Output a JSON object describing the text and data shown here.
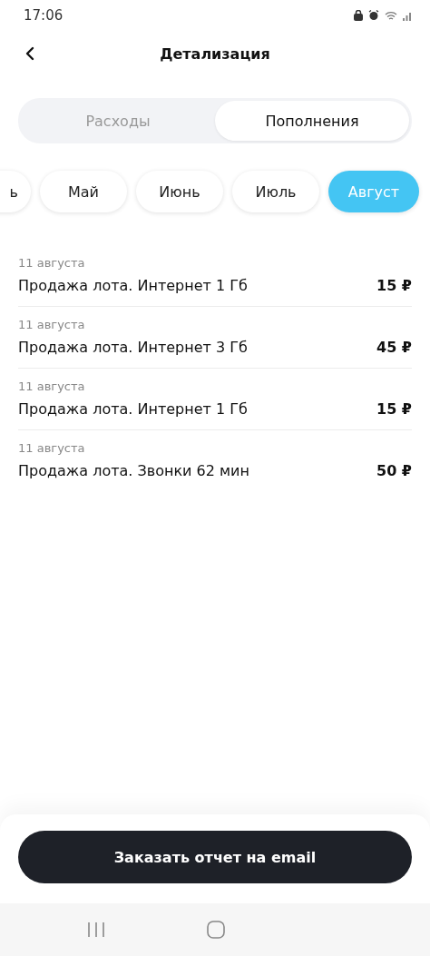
{
  "status_bar": {
    "time": "17:06"
  },
  "header": {
    "title": "Детализация"
  },
  "segments": [
    {
      "label": "Расходы",
      "selected": false
    },
    {
      "label": "Пополнения",
      "selected": true
    }
  ],
  "months": [
    {
      "label": "ь",
      "selected": false
    },
    {
      "label": "Май",
      "selected": false
    },
    {
      "label": "Июнь",
      "selected": false
    },
    {
      "label": "Июль",
      "selected": false
    },
    {
      "label": "Август",
      "selected": true
    }
  ],
  "transactions": [
    {
      "date": "11 августа",
      "title": "Продажа лота. Интернет 1 Гб",
      "amount": "15 ₽"
    },
    {
      "date": "11 августа",
      "title": "Продажа лота. Интернет 3 Гб",
      "amount": "45 ₽"
    },
    {
      "date": "11 августа",
      "title": "Продажа лота. Интернет 1 Гб",
      "amount": "15 ₽"
    },
    {
      "date": "11 августа",
      "title": "Продажа лота. Звонки 62 мин",
      "amount": "50 ₽"
    }
  ],
  "action_button": {
    "label": "Заказать отчет на email"
  }
}
